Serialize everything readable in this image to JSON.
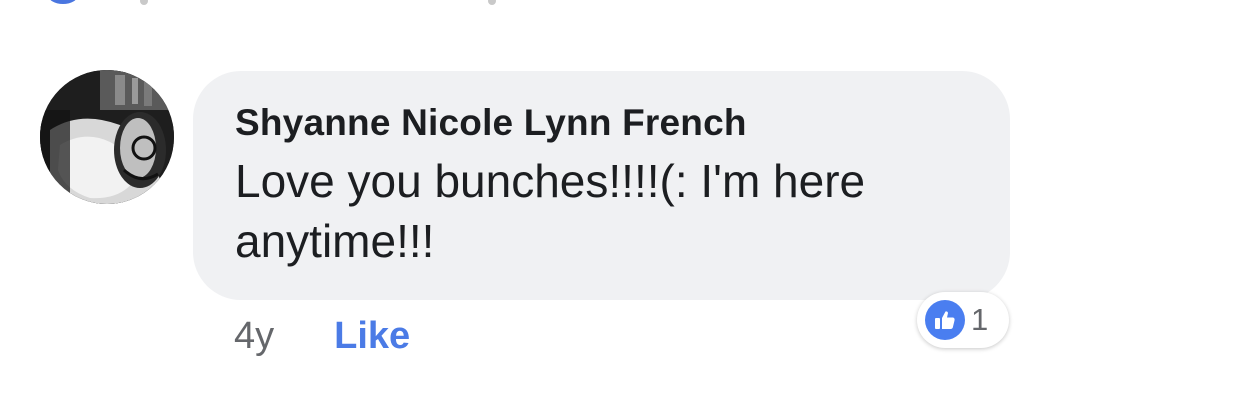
{
  "comment": {
    "author": "Shyanne Nicole Lynn French",
    "text": "Love you bunches!!!!(: I'm here anytime!!!",
    "timestamp": "4y",
    "like_action_label": "Like",
    "reaction_count": "1",
    "reaction_type": "like-icon"
  },
  "colors": {
    "bubble_bg": "#f0f1f3",
    "link_blue": "#4b7be6",
    "reaction_blue": "#4a7ef0",
    "meta_gray": "#65676b"
  }
}
